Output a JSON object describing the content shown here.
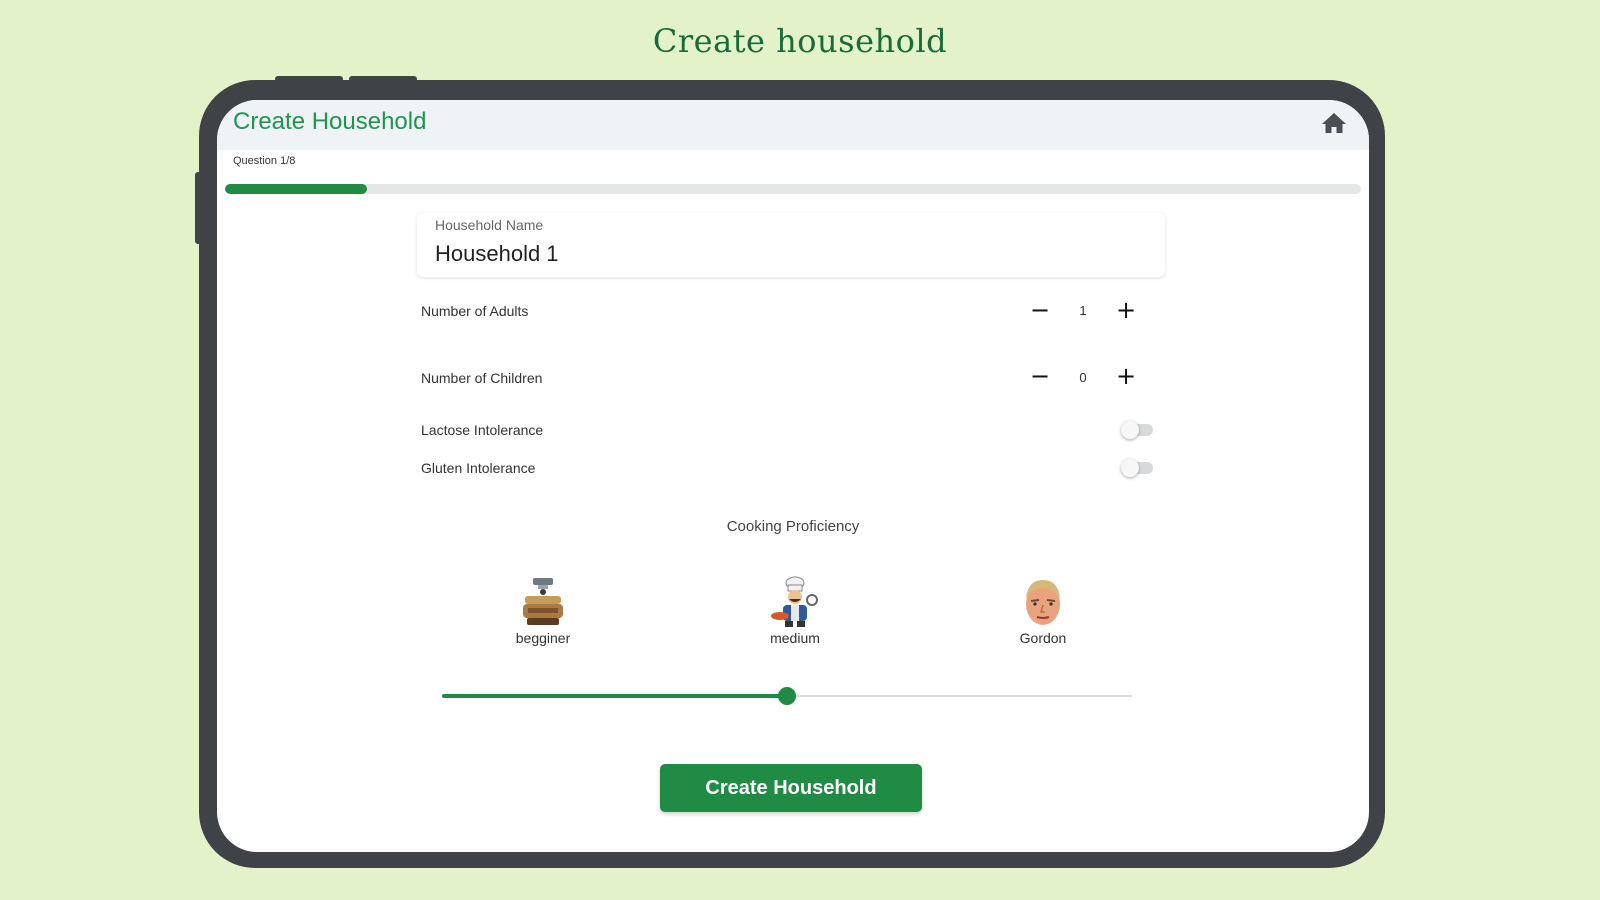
{
  "promo": {
    "title": "Create household"
  },
  "appbar": {
    "title": "Create Household",
    "icon": "home-icon"
  },
  "progress": {
    "label": "Question 1/8",
    "current": 1,
    "total": 8,
    "fraction": 0.125
  },
  "form": {
    "household_name": {
      "label": "Household Name",
      "value": "Household 1"
    },
    "adults": {
      "label": "Number of Adults",
      "value": "1",
      "minus": "−",
      "plus": "+"
    },
    "children": {
      "label": "Number of Children",
      "value": "0",
      "minus": "−",
      "plus": "+"
    },
    "lactose": {
      "label": "Lactose Intolerance",
      "enabled": false
    },
    "gluten": {
      "label": "Gluten Intolerance",
      "enabled": false
    }
  },
  "cooking": {
    "title": "Cooking Proficiency",
    "levels": [
      {
        "label": "begginer",
        "icon": "beginner-cook-icon"
      },
      {
        "label": "medium",
        "icon": "chef-icon"
      },
      {
        "label": "Gordon",
        "icon": "gordon-face-icon"
      }
    ],
    "slider_fraction": 0.5
  },
  "submit": {
    "label": "Create Household"
  },
  "colors": {
    "accent": "#1f8b45",
    "background": "#e3f2c8",
    "device": "#3f4246",
    "appbar": "#eff3f5"
  }
}
